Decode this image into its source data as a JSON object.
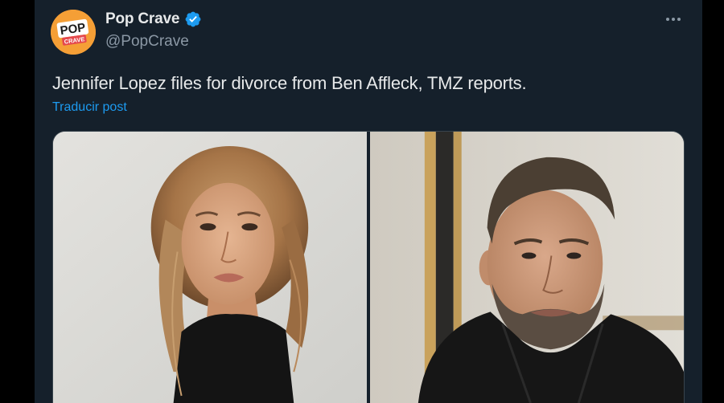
{
  "author": {
    "display_name": "Pop Crave",
    "handle": "@PopCrave",
    "avatar_text_top": "POP",
    "avatar_text_bottom": "CRAVE",
    "verified": true
  },
  "post": {
    "text": "Jennifer Lopez files for divorce from Ben Affleck, TMZ reports.",
    "translate_label": "Traducir post"
  },
  "media": {
    "photos": [
      {
        "name": "photo-jennifer-lopez",
        "description_icon": "photo-left"
      },
      {
        "name": "photo-ben-affleck",
        "description_icon": "photo-right"
      }
    ]
  },
  "icons": {
    "verified": "verified-badge-icon",
    "more": "more-options-icon"
  },
  "colors": {
    "background": "#15202b",
    "text_primary": "#e7e9ea",
    "text_secondary": "#8b98a5",
    "link": "#1d9bf0",
    "verified": "#1d9bf0"
  }
}
